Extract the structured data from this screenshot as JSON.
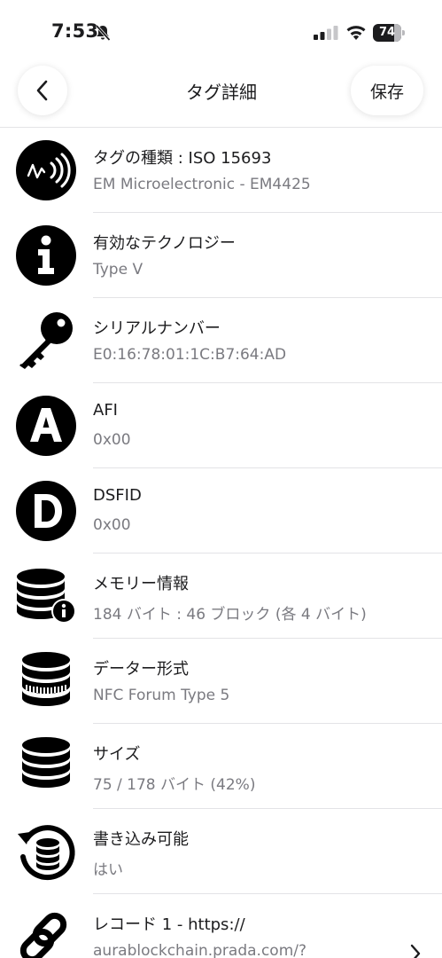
{
  "status_bar": {
    "time": "7:53",
    "battery": "74",
    "battery_level_fraction": 0.74
  },
  "nav": {
    "title": "タグ詳細",
    "save_label": "保存",
    "back_icon": "chevron-left-icon"
  },
  "rows": [
    {
      "icon": "nfc-tag-icon",
      "title": "タグの種類 : ISO 15693",
      "subtitle": "EM Microelectronic - EM4425"
    },
    {
      "icon": "info-icon",
      "title": "有効なテクノロジー",
      "subtitle": "Type V"
    },
    {
      "icon": "key-icon",
      "title": "シリアルナンバー",
      "subtitle": "E0:16:78:01:1C:B7:64:AD"
    },
    {
      "icon": "letter-a-icon",
      "title": "AFI",
      "subtitle": "0x00"
    },
    {
      "icon": "letter-d-icon",
      "title": "DSFID",
      "subtitle": "0x00"
    },
    {
      "icon": "database-info-icon",
      "title": "メモリー情報",
      "subtitle": "184 バイト : 46 ブロック (各 4 バイト)"
    },
    {
      "icon": "database-format-icon",
      "title": "データー形式",
      "subtitle": "NFC Forum Type 5"
    },
    {
      "icon": "database-icon",
      "title": "サイズ",
      "subtitle": "75 / 178 バイト (42%)"
    },
    {
      "icon": "database-write-icon",
      "title": "書き込み可能",
      "subtitle": "はい"
    },
    {
      "icon": "link-icon",
      "title": "レコード 1 - https://",
      "subtitle": "aurablockchain.prada.com/?"
    }
  ]
}
